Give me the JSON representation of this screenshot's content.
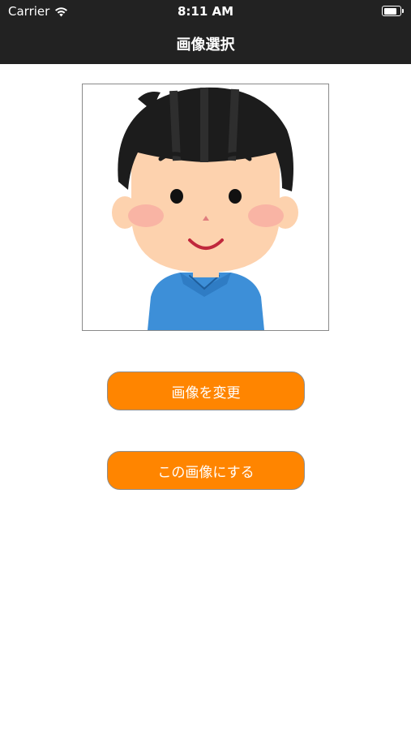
{
  "status_bar": {
    "carrier": "Carrier",
    "time": "8:11 AM",
    "wifi_icon": "wifi-icon",
    "battery_icon": "battery-icon"
  },
  "nav": {
    "title": "画像選択"
  },
  "image": {
    "subject": "avatar-illustration"
  },
  "buttons": {
    "change_label": "画像を変更",
    "use_label": "この画像にする"
  },
  "colors": {
    "nav_background": "#222222",
    "button_background": "#ff8500",
    "button_text": "#ffffff"
  }
}
